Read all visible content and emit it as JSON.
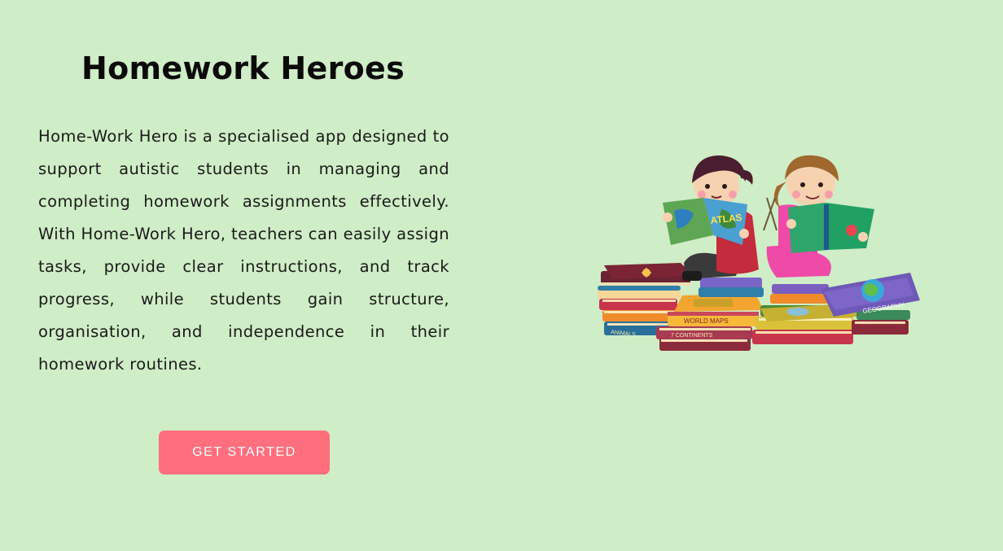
{
  "hero": {
    "title": "Homework Heroes",
    "description": "Home-Work Hero is a specialised app designed to support autistic students in managing and completing homework assignments effectively. With Home-Work Hero, teachers can easily assign tasks, provide clear instructions, and track progress, while students gain structure, organisation, and independence in their homework routines.",
    "cta_label": "GET STARTED"
  },
  "illustration": {
    "icon": "kids-reading-books-illustration",
    "book_labels": [
      "ATLAS",
      "WORLD MAPS",
      "7 CONTINENTS",
      "GEOGRAPHY",
      "ANIMALS"
    ]
  },
  "colors": {
    "background": "#cfedc6",
    "cta": "#fd6f7d",
    "text": "#0a0a0a"
  }
}
